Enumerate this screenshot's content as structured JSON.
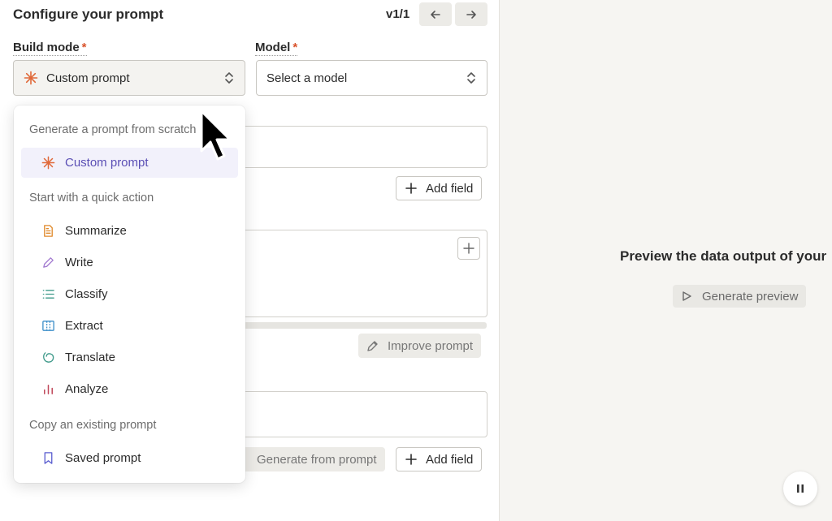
{
  "header": {
    "title": "Configure your prompt",
    "version": "v1/1"
  },
  "build_mode": {
    "label": "Build mode",
    "required_mark": "*",
    "selected": "Custom prompt"
  },
  "model": {
    "label": "Model",
    "required_mark": "*",
    "placeholder": "Select a model"
  },
  "dropdown": {
    "section_generate": "Generate a prompt from scratch",
    "custom_prompt": "Custom prompt",
    "section_quick": "Start with a quick action",
    "quick_actions": [
      "Summarize",
      "Write",
      "Classify",
      "Extract",
      "Translate",
      "Analyze"
    ],
    "section_copy": "Copy an existing prompt",
    "saved_prompt": "Saved prompt"
  },
  "buttons": {
    "add_field": "Add field",
    "improve_prompt": "Improve prompt",
    "generate_from_prompt": "Generate from prompt",
    "add_field_2": "Add field"
  },
  "preview": {
    "message": "Preview the data output of your",
    "button": "Generate preview"
  },
  "colors": {
    "accent_orange": "#e0693a",
    "selected_purple": "#5b4fb5"
  }
}
